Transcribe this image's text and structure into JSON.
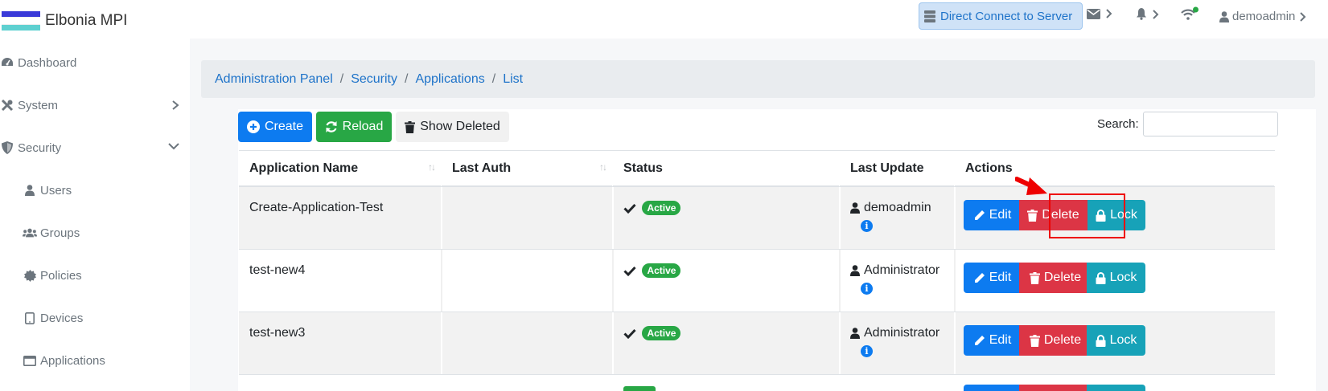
{
  "app": {
    "title": "Elbonia MPI",
    "flag_colors": [
      "#3a3ad8",
      "#ffffff",
      "#5ed0d0"
    ]
  },
  "header": {
    "direct_connect_label": "Direct Connect to Server",
    "username": "demoadmin"
  },
  "sidebar": {
    "items": [
      {
        "label": "Dashboard",
        "icon": "dashboard-icon"
      },
      {
        "label": "System",
        "icon": "tools-icon",
        "expanded": false
      },
      {
        "label": "Security",
        "icon": "shield-icon",
        "expanded": true
      },
      {
        "label": "Users",
        "icon": "user-icon"
      },
      {
        "label": "Groups",
        "icon": "users-icon"
      },
      {
        "label": "Policies",
        "icon": "certificate-icon"
      },
      {
        "label": "Devices",
        "icon": "tablet-icon"
      },
      {
        "label": "Applications",
        "icon": "window-icon"
      }
    ]
  },
  "breadcrumb": [
    "Administration Panel",
    "Security",
    "Applications",
    "List"
  ],
  "toolbar": {
    "create_label": "Create",
    "reload_label": "Reload",
    "show_deleted_label": "Show Deleted",
    "search_label": "Search:",
    "search_value": ""
  },
  "table": {
    "columns": [
      "Application Name",
      "Last Auth",
      "Status",
      "Last Update",
      "Actions"
    ],
    "rows": [
      {
        "name": "Create-Application-Test",
        "last_auth": "",
        "status": "Active",
        "updated_by": "demoadmin"
      },
      {
        "name": "test-new4",
        "last_auth": "",
        "status": "Active",
        "updated_by": "Administrator"
      },
      {
        "name": "test-new3",
        "last_auth": "",
        "status": "Active",
        "updated_by": "Administrator"
      }
    ],
    "action_labels": {
      "edit": "Edit",
      "delete": "Delete",
      "lock": "Lock"
    }
  },
  "colors": {
    "primary": "#0d7bf0",
    "success": "#28a745",
    "danger": "#dc3545",
    "info": "#17a2b8",
    "annotation": "#ee0000"
  }
}
